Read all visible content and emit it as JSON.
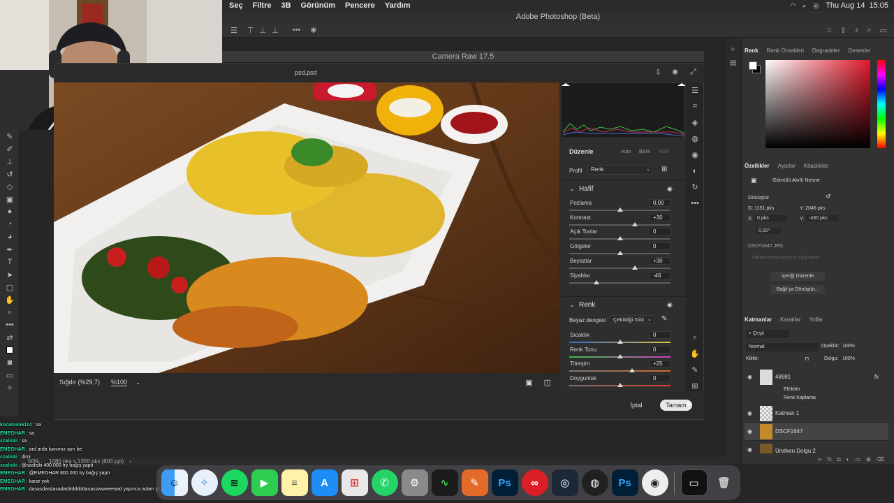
{
  "menubar": {
    "items": [
      "Seç",
      "Filtre",
      "3B",
      "Görünüm",
      "Pencere",
      "Yardım"
    ],
    "status_date": "Thu Aug 14",
    "status_time": "15:05"
  },
  "app_title": "Adobe Photoshop (Beta)",
  "camera_raw": {
    "title": "Camera Raw 17.5",
    "filename": "psd.psd",
    "zoom_fit": "Sığdır (%29,7)",
    "zoom_100": "%100",
    "panel": {
      "section_partial": "Düzenle",
      "section_partial_btns": [
        "Auto",
        "B&W",
        "HDR"
      ],
      "profile_label": "Profil",
      "profile_value": "Renk",
      "light_title": "Hafif",
      "light_sliders": [
        {
          "label": "Pozlama",
          "value": "0,00",
          "pos": 0.5
        },
        {
          "label": "Kontrast",
          "value": "+30",
          "pos": 0.65
        },
        {
          "label": "Açık Tonlar",
          "value": "0",
          "pos": 0.5
        },
        {
          "label": "Gölgeler",
          "value": "0",
          "pos": 0.5
        },
        {
          "label": "Beyazlar",
          "value": "+30",
          "pos": 0.65
        },
        {
          "label": "Siyahlar",
          "value": "-46",
          "pos": 0.27
        }
      ],
      "color_title": "Renk",
      "wb_label": "Beyaz dengesi",
      "wb_value": "Çekildiği Gibi",
      "color_sliders": [
        {
          "label": "Sıcaklık",
          "value": "0",
          "pos": 0.5
        },
        {
          "label": "Renk Tonu",
          "value": "0",
          "pos": 0.5
        },
        {
          "label": "Titreşim",
          "value": "+25",
          "pos": 0.62
        },
        {
          "label": "Doygunluk",
          "value": "0",
          "pos": 0.5
        }
      ]
    },
    "cancel_label": "İptal",
    "ok_label": "Tamam"
  },
  "right_panel": {
    "color_tabs": [
      "Renk",
      "Renk Örnekleri",
      "Degradeler",
      "Desenler"
    ],
    "prop_tabs": [
      "Özellikler",
      "Ayarlar",
      "Kitaplıklar"
    ],
    "smart_object": "Gömülü Akıllı Nesne",
    "transform_title": "Dönüştür",
    "w": "G: 1151 pks",
    "h": "Y: 2046 pks",
    "x": "0 pks",
    "y": "-430 pks",
    "x_label": "X:",
    "y_label": "Y:",
    "angle": "0,00°",
    "file": "DSCF1647.JPG",
    "layer_comp": "Katman kompozisyonu Uygulama",
    "edit_content": "İçeriği Düzenle",
    "convert_linked": "Bağlı'ya Dönüştür...",
    "layer_tabs": [
      "Katmanlar",
      "Kanallar",
      "Yollar"
    ],
    "filter_kind": "Çeşit",
    "blend_mode": "Normal",
    "opacity_label": "Opaklık:",
    "opacity": "100%",
    "lock_label": "Kilitle:",
    "fill_label": "Dolgu:",
    "fill": "100%",
    "layers": [
      {
        "name": "48981",
        "sub": "Efektler",
        "sub2": "Renk Kaplama"
      },
      {
        "name": "Katman 1"
      },
      {
        "name": "DSCF1647"
      },
      {
        "name": "Üretken Dolgu 2"
      }
    ]
  },
  "statusbar": {
    "zoom": "50%",
    "size": "1080 pks x 1350 pks (800 ppi)"
  },
  "chat": [
    {
      "name": "kocaman6114",
      "text": "sa"
    },
    {
      "name": "EMEGHAR",
      "text": "sa"
    },
    {
      "name": "szaliski",
      "text": "sa"
    },
    {
      "name": "EMEGHAR",
      "text": "ard arda kanımız ayrı be"
    },
    {
      "name": "szaliski",
      "text": "dimi"
    },
    {
      "name": "szaliski",
      "text": "@szaliski 400.000 try bağış yaptı"
    },
    {
      "name": "EMEGHAR",
      "text": "@EMEGHAR 800.000 try bağış yaptı"
    },
    {
      "name": "EMEGHAR",
      "text": "karar yok"
    },
    {
      "name": "EMEGHAR",
      "text": "dasasdasdasadadddddddasasswwweeaad yapınca adam gidiyo oyunda"
    }
  ],
  "dock": [
    "Finder",
    "Safari",
    "Spotify",
    "FaceTime",
    "Notes",
    "App Store",
    "Launchpad",
    "WhatsApp",
    "System Settings",
    "Activity Monitor",
    "Pages",
    "Ps",
    "Creative Cloud",
    "Steam",
    "OBS",
    "Ps",
    "Webcam",
    "Screen",
    "Trash"
  ],
  "colors": {
    "accent": "#2b82d9",
    "bg": "#262626",
    "panel": "#323232"
  }
}
